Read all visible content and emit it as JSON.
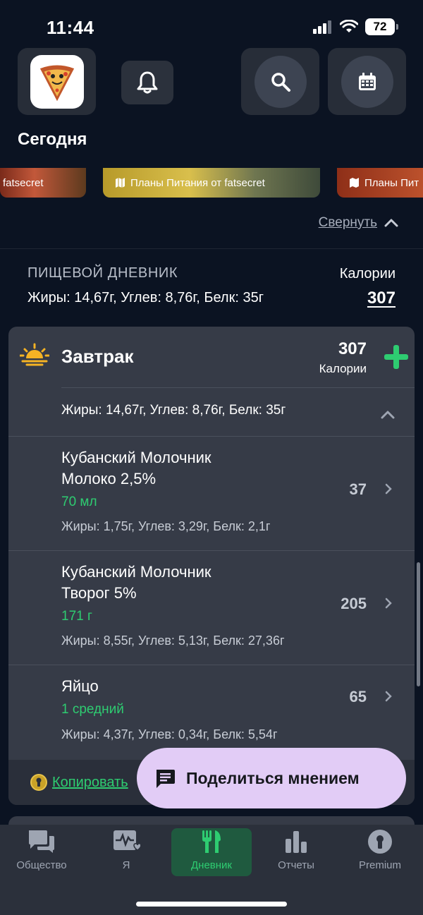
{
  "status": {
    "time": "11:44",
    "battery": "72"
  },
  "header": {
    "title": "Сегодня"
  },
  "banners": [
    {
      "label": "fatsecret"
    },
    {
      "label": "Планы Питания от fatsecret"
    },
    {
      "label": "Планы Пит"
    }
  ],
  "collapse_label": "Свернуть",
  "diary": {
    "section_title": "ПИЩЕВОЙ ДНЕВНИК",
    "macros": "Жиры: 14,67г, Углев: 8,76г, Белк: 35г",
    "calories_label": "Калории",
    "calories_total": "307"
  },
  "meal": {
    "name": "Завтрак",
    "calories": "307",
    "calories_label": "Калории",
    "macros": "Жиры: 14,67г, Углев: 8,76г, Белк: 35г",
    "items": [
      {
        "name_line1": "Кубанский Молочник",
        "name_line2": "Молоко 2,5%",
        "qty": "70 мл",
        "macros": "Жиры: 1,75г, Углев: 3,29г, Белк: 2,1г",
        "cal": "37"
      },
      {
        "name_line1": "Кубанский Молочник",
        "name_line2": "Творог 5%",
        "qty": "171 г",
        "macros": "Жиры: 8,55г, Углев: 5,13г, Белк: 27,36г",
        "cal": "205"
      },
      {
        "name_line1": "Яйцо",
        "name_line2": "",
        "qty": "1 средний",
        "macros": "Жиры: 4,37г, Углев: 0,34г, Белк: 5,54г",
        "cal": "65"
      }
    ],
    "copy_label": "Копировать"
  },
  "feedback": {
    "label": "Поделиться мнением"
  },
  "tabs": [
    {
      "label": "Общество",
      "icon": "chat-icon",
      "active": false
    },
    {
      "label": "Я",
      "icon": "health-icon",
      "active": false
    },
    {
      "label": "Дневник",
      "icon": "utensils-icon",
      "active": true
    },
    {
      "label": "Отчеты",
      "icon": "bar-chart-icon",
      "active": false
    },
    {
      "label": "Premium",
      "icon": "premium-icon",
      "active": false
    }
  ],
  "colors": {
    "accent_green": "#2ecc71",
    "background": "#0b1322",
    "card": "#363b47",
    "feedback_bg": "#e2ccf6"
  }
}
